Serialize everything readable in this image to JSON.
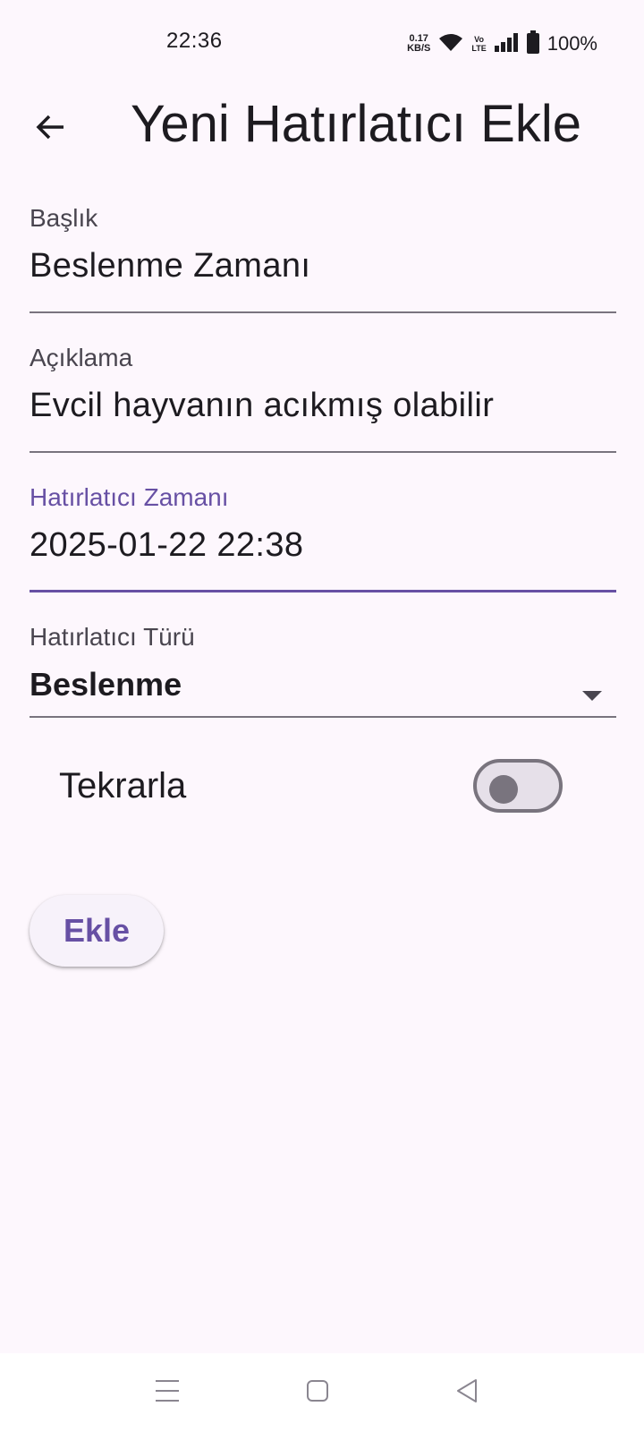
{
  "status_bar": {
    "time": "22:36",
    "net_speed_value": "0.17",
    "net_speed_unit": "KB/S",
    "volte_top": "Vo",
    "volte_bottom": "LTE",
    "battery_percent": "100%",
    "icons": [
      "wifi-icon",
      "signal-icon",
      "battery-icon"
    ]
  },
  "app_bar": {
    "title": "Yeni Hatırlatıcı Ekle",
    "back_icon": "arrow-back-icon"
  },
  "form": {
    "title_field": {
      "label": "Başlık",
      "value": "Beslenme Zamanı"
    },
    "description_field": {
      "label": "Açıklama",
      "value": "Evcil hayvanın acıkmış olabilir"
    },
    "time_field": {
      "label": "Hatırlatıcı Zamanı",
      "value": "2025-01-22 22:38"
    },
    "type_dropdown": {
      "label": "Hatırlatıcı Türü",
      "value": "Beslenme",
      "icon": "dropdown-arrow-icon"
    },
    "repeat_switch": {
      "label": "Tekrarla",
      "on": false
    },
    "add_button_label": "Ekle"
  },
  "nav_bar": {
    "icons": [
      "menu-icon",
      "home-icon",
      "back-triangle-icon"
    ]
  },
  "colors": {
    "background": "#fdf7fd",
    "accent": "#6750a4",
    "outline": "#79747e",
    "text": "#1d1b20"
  }
}
